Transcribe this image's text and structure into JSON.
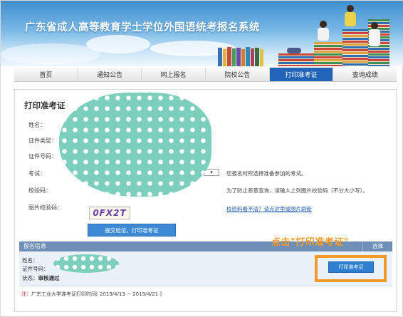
{
  "banner": {
    "title": "广东省成人高等教育学士学位外国语统考报名系统"
  },
  "nav": {
    "items": [
      {
        "label": "首页",
        "active": false
      },
      {
        "label": "通知公告",
        "active": false
      },
      {
        "label": "网上报名",
        "active": false
      },
      {
        "label": "院校公告",
        "active": false
      },
      {
        "label": "打印准考证",
        "active": true
      },
      {
        "label": "查询成绩",
        "active": false
      }
    ]
  },
  "form": {
    "title": "打印准考证",
    "name_label": "姓名：",
    "idtype_label": "证件类型：",
    "idnum_label": "证件号码：",
    "exam_label": "考试：",
    "exam_hint": "您报名时所选择准备参加的考试。",
    "exam_select_value": "▾",
    "verify_label": "校验码：",
    "verify_hint": "为了防止恶意查询，请输入上列图片校验码（不分大小写）。",
    "captcha_label": "图片校验码：",
    "captcha_text": "0FX2T",
    "refresh_link": "校验码看不清？请点这里或图片刷新",
    "submit_label": "提交验证，打印准考证"
  },
  "registration": {
    "bar_title": "报名信息",
    "select_col": "选择",
    "name_line": "姓名：",
    "id_line": "证件号码：",
    "status_label": "状态：",
    "status_value": "审核通过",
    "print_button": "打印准考证",
    "callout": "点击\"打印准考证\""
  },
  "note": {
    "star": "注：",
    "text": "广东工业大学准考证打印时间[ 2019/4/13 ~ 2019/4/21 ]"
  },
  "colors": {
    "accent": "#1f64b8",
    "highlight": "#f39a2b",
    "mask": "#7ccfbd"
  }
}
